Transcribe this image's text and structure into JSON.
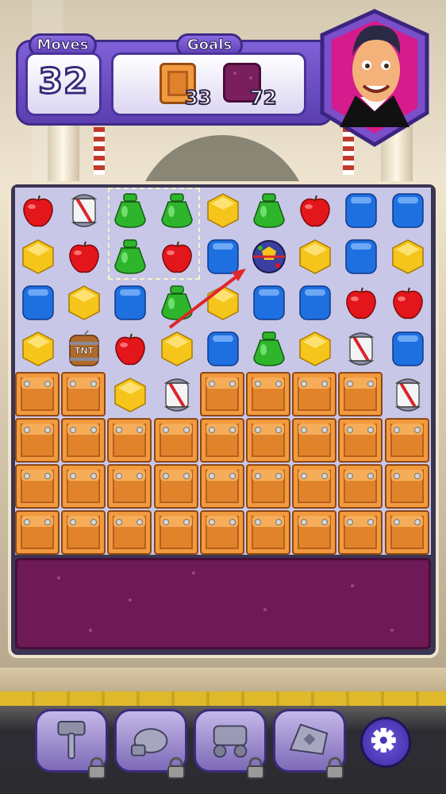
{
  "hud": {
    "moves_label": "Moves",
    "moves_value": "32",
    "goals_label": "Goals",
    "goals": [
      {
        "item": "crate-icon",
        "count": "33"
      },
      {
        "item": "purple-tile-icon",
        "count": "72"
      }
    ]
  },
  "board": {
    "cols": 9,
    "rows_visible": 8,
    "grid": [
      [
        "apple",
        "rocket",
        "pot",
        "pot",
        "hex",
        "pot",
        "apple",
        "cube",
        "cube"
      ],
      [
        "hex",
        "apple",
        "pot",
        "apple",
        "cube",
        "ball",
        "hex",
        "cube",
        "hex"
      ],
      [
        "cube",
        "hex",
        "cube",
        "pot",
        "hex",
        "cube",
        "cube",
        "apple",
        "apple"
      ],
      [
        "hex",
        "tnt",
        "apple",
        "hex",
        "cube",
        "pot",
        "hex",
        "rocket",
        "cube"
      ],
      [
        "crate",
        "crate",
        "hex",
        "rocket",
        "crate",
        "crate",
        "crate",
        "crate",
        "rocket"
      ],
      [
        "crate",
        "crate",
        "crate",
        "crate",
        "crate",
        "crate",
        "crate",
        "crate",
        "crate"
      ],
      [
        "crate",
        "crate",
        "crate",
        "crate",
        "crate",
        "crate",
        "crate",
        "crate",
        "crate"
      ],
      [
        "crate",
        "crate",
        "crate",
        "crate",
        "crate",
        "crate",
        "crate",
        "crate",
        "crate"
      ]
    ],
    "tnt_label": "TNT"
  },
  "colors": {
    "apple": "#e3161b",
    "pot": "#2fb52c",
    "hex": "#f5c51b",
    "cube": "#1e6fe0",
    "crate": "#e0832b",
    "purple_tile": "#6e1a56",
    "accent": "#5b3fb1"
  },
  "boosters": [
    {
      "name": "hammer-icon",
      "locked": true
    },
    {
      "name": "glove-icon",
      "locked": true
    },
    {
      "name": "cannon-icon",
      "locked": true
    },
    {
      "name": "jester-hat-icon",
      "locked": true
    }
  ],
  "settings": {
    "icon": "gear-icon"
  }
}
